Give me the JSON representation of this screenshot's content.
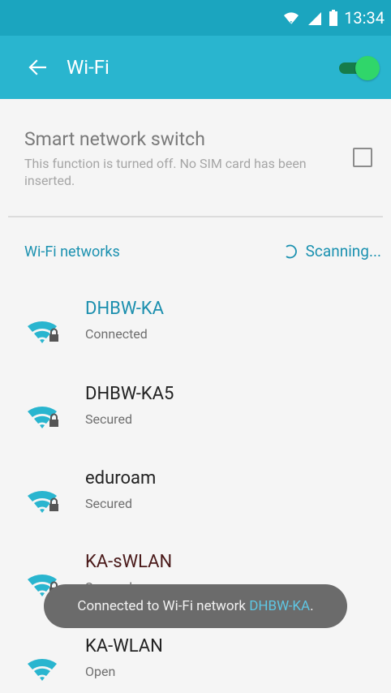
{
  "statusbar": {
    "time": "13:34"
  },
  "appbar": {
    "title": "Wi-Fi",
    "wifi_enabled": true
  },
  "smart_switch": {
    "title": "Smart network switch",
    "description": "This function is turned off. No SIM card has been inserted.",
    "checked": false
  },
  "networks_header": {
    "title": "Wi-Fi networks",
    "scanning": "Scanning..."
  },
  "networks": [
    {
      "name": "DHBW-KA",
      "status": "Connected",
      "secured": true
    },
    {
      "name": "DHBW-KA5",
      "status": "Secured",
      "secured": true
    },
    {
      "name": "eduroam",
      "status": "Secured",
      "secured": true
    },
    {
      "name": "KA-sWLAN",
      "status": "Secured",
      "secured": true
    },
    {
      "name": "KA-WLAN",
      "status": "Open",
      "secured": false
    }
  ],
  "toast": {
    "prefix": "Connected to Wi-Fi network ",
    "network": "DHBW-KA",
    "suffix": "."
  },
  "colors": {
    "accent": "#29b5cf",
    "statusbar": "#1ba5bf",
    "link": "#1b91b0",
    "toggle_on": "#30d66a"
  }
}
